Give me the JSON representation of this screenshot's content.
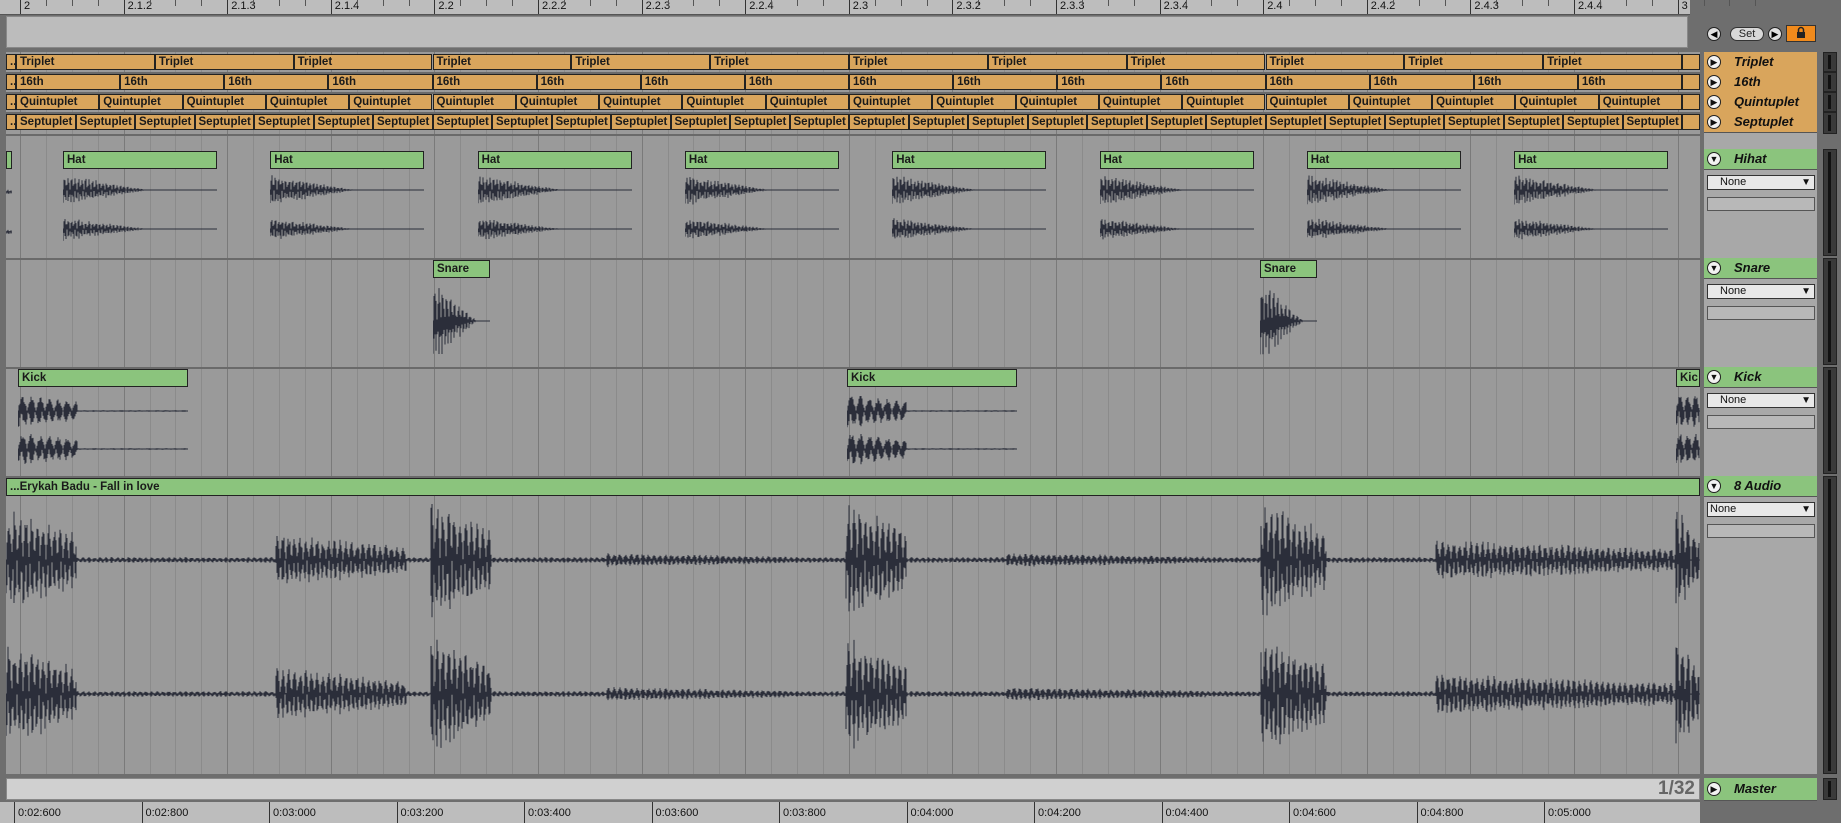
{
  "ruler_top": {
    "labels": [
      "2",
      "2.1.2",
      "2.1.3",
      "2.1.4",
      "2.2",
      "2.2.2",
      "2.2.3",
      "2.2.4",
      "2.3",
      "2.3.2",
      "2.3.3",
      "2.3.4",
      "2.4",
      "2.4.2",
      "2.4.3",
      "2.4.4",
      "3"
    ]
  },
  "ruler_bottom": {
    "labels": [
      "0:02:600",
      "0:02:800",
      "0:03:000",
      "0:03:200",
      "0:03:400",
      "0:03:600",
      "0:03:800",
      "0:04:000",
      "0:04:200",
      "0:04:400",
      "0:04:600",
      "0:04:800",
      "0:05:000"
    ]
  },
  "controls": {
    "set_label": "Set",
    "left_arrow": "◀",
    "right_arrow": "▶",
    "quantization": "1/32"
  },
  "clips": {
    "triplet": "Triplet",
    "sixteenth": "16th",
    "quintuplet": "Quintuplet",
    "septuplet": "Septuplet",
    "hat": "Hat",
    "snare": "Snare",
    "kick": "Kick",
    "kick_partial": "Kic",
    "audio": "...Erykah Badu - Fall in love"
  },
  "tracks": [
    {
      "name": "Triplet",
      "color": "#d9a55c"
    },
    {
      "name": "16th",
      "color": "#d9a55c"
    },
    {
      "name": "Quintuplet",
      "color": "#d9a55c"
    },
    {
      "name": "Septuplet",
      "color": "#d9a55c"
    },
    {
      "name": "Hihat",
      "color": "#8bc47d",
      "input": "None"
    },
    {
      "name": "Snare",
      "color": "#8bc47d",
      "input": "None"
    },
    {
      "name": "Kick",
      "color": "#8bc47d",
      "input": "None"
    },
    {
      "name": "8 Audio",
      "color": "#8bc47d",
      "input": "None"
    },
    {
      "name": "Master",
      "color": "#8bc47d"
    }
  ],
  "icons": {
    "track_expand": "triangle-right-icon",
    "track_collapse": "triangle-down-icon",
    "lock": "lock-icon"
  }
}
